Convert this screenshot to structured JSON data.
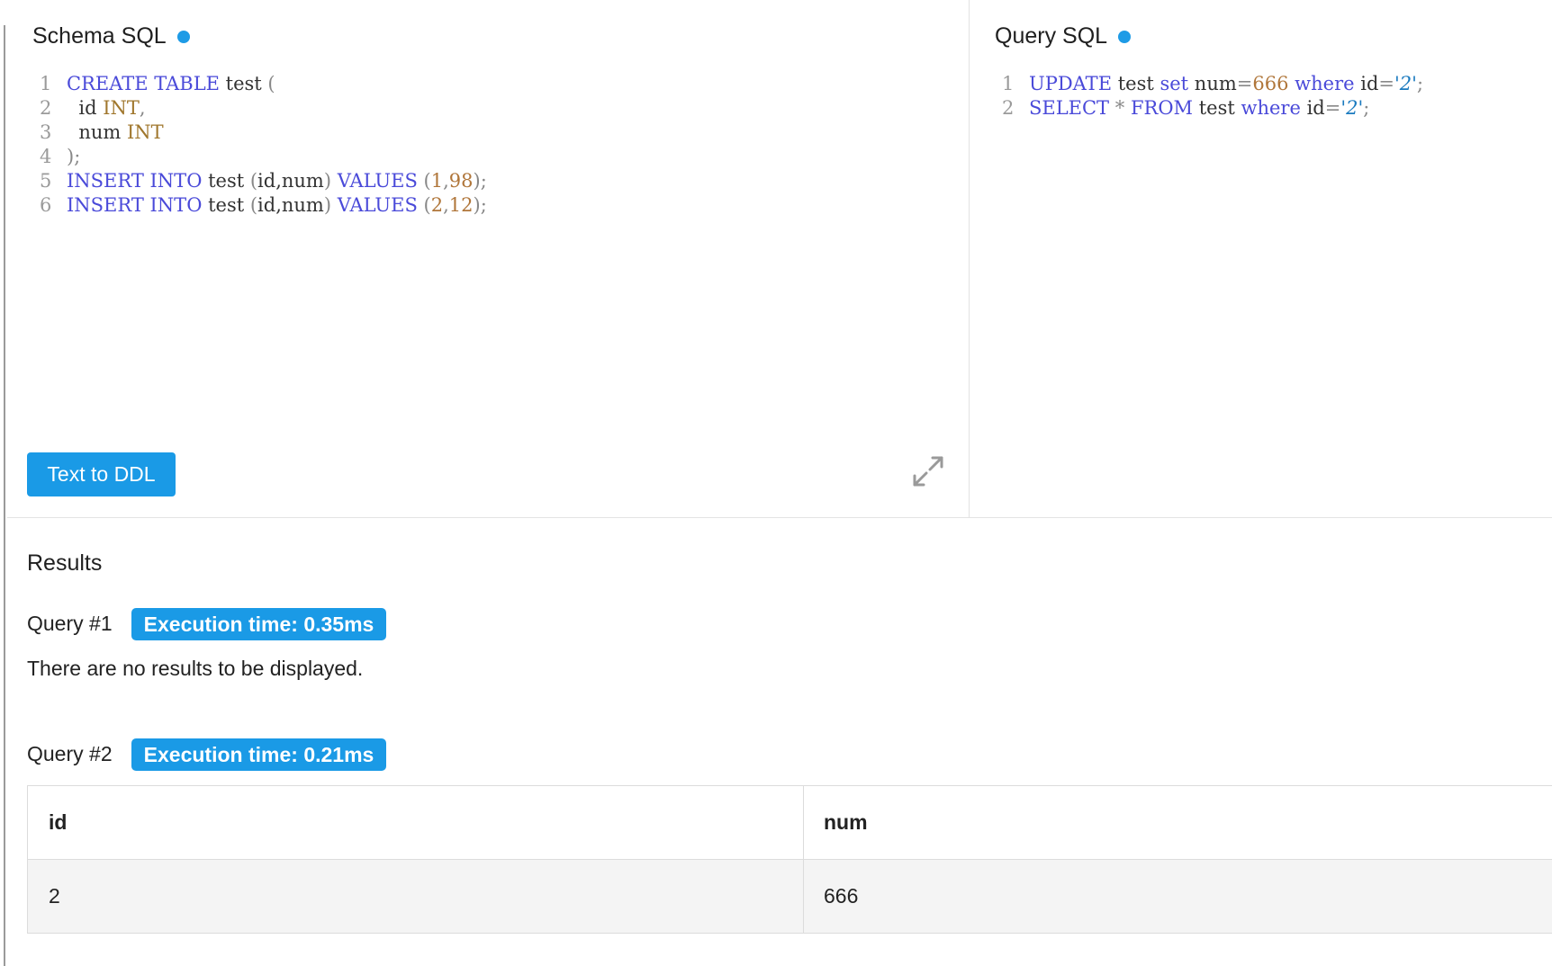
{
  "schema": {
    "title": "Schema SQL",
    "lines": [
      {
        "n": "1",
        "tokens": [
          {
            "t": "CREATE TABLE",
            "c": "kw"
          },
          {
            "t": " test ",
            "c": "pl"
          },
          {
            "t": "(",
            "c": "pun"
          }
        ]
      },
      {
        "n": "2",
        "tokens": [
          {
            "t": "  id ",
            "c": "pl"
          },
          {
            "t": "INT",
            "c": "ty"
          },
          {
            "t": ",",
            "c": "pun"
          }
        ]
      },
      {
        "n": "3",
        "tokens": [
          {
            "t": "  num ",
            "c": "pl"
          },
          {
            "t": "INT",
            "c": "ty"
          }
        ]
      },
      {
        "n": "4",
        "tokens": [
          {
            "t": ");",
            "c": "pun"
          }
        ]
      },
      {
        "n": "5",
        "tokens": [
          {
            "t": "INSERT INTO",
            "c": "kw"
          },
          {
            "t": " test ",
            "c": "pl"
          },
          {
            "t": "(",
            "c": "pun"
          },
          {
            "t": "id,num",
            "c": "pl"
          },
          {
            "t": ") ",
            "c": "pun"
          },
          {
            "t": "VALUES",
            "c": "kw"
          },
          {
            "t": " (",
            "c": "pun"
          },
          {
            "t": "1",
            "c": "num"
          },
          {
            "t": ",",
            "c": "pun"
          },
          {
            "t": "98",
            "c": "num"
          },
          {
            "t": ");",
            "c": "pun"
          }
        ]
      },
      {
        "n": "6",
        "tokens": [
          {
            "t": "INSERT INTO",
            "c": "kw"
          },
          {
            "t": " test ",
            "c": "pl"
          },
          {
            "t": "(",
            "c": "pun"
          },
          {
            "t": "id,num",
            "c": "pl"
          },
          {
            "t": ") ",
            "c": "pun"
          },
          {
            "t": "VALUES",
            "c": "kw"
          },
          {
            "t": " (",
            "c": "pun"
          },
          {
            "t": "2",
            "c": "num"
          },
          {
            "t": ",",
            "c": "pun"
          },
          {
            "t": "12",
            "c": "num"
          },
          {
            "t": ");",
            "c": "pun"
          }
        ]
      }
    ],
    "ddl_button": "Text to DDL",
    "expand_icon": "expand-icon"
  },
  "query": {
    "title": "Query SQL",
    "lines": [
      {
        "n": "1",
        "tokens": [
          {
            "t": "UPDATE",
            "c": "kw"
          },
          {
            "t": " test ",
            "c": "pl"
          },
          {
            "t": "set",
            "c": "kw"
          },
          {
            "t": " num",
            "c": "pl"
          },
          {
            "t": "=",
            "c": "pun"
          },
          {
            "t": "666",
            "c": "num"
          },
          {
            "t": " ",
            "c": "pl"
          },
          {
            "t": "where",
            "c": "kw"
          },
          {
            "t": " id",
            "c": "pl"
          },
          {
            "t": "=",
            "c": "pun"
          },
          {
            "t": "'2'",
            "c": "str"
          },
          {
            "t": ";",
            "c": "pun"
          }
        ]
      },
      {
        "n": "2",
        "tokens": [
          {
            "t": "SELECT",
            "c": "kw"
          },
          {
            "t": " ",
            "c": "pl"
          },
          {
            "t": "*",
            "c": "pun"
          },
          {
            "t": " ",
            "c": "pl"
          },
          {
            "t": "FROM",
            "c": "kw"
          },
          {
            "t": " test ",
            "c": "pl"
          },
          {
            "t": "where",
            "c": "kw"
          },
          {
            "t": " id",
            "c": "pl"
          },
          {
            "t": "=",
            "c": "pun"
          },
          {
            "t": "'2'",
            "c": "str"
          },
          {
            "t": ";",
            "c": "pun"
          }
        ]
      }
    ]
  },
  "results": {
    "title": "Results",
    "queries": [
      {
        "label": "Query #1",
        "exec_time": "Execution time: 0.35ms",
        "message": "There are no results to be displayed."
      },
      {
        "label": "Query #2",
        "exec_time": "Execution time: 0.21ms",
        "columns": [
          "id",
          "num"
        ],
        "rows": [
          [
            "2",
            "666"
          ]
        ]
      }
    ]
  },
  "colors": {
    "accent": "#1a9ae6",
    "keyword": "#4a4ad9",
    "type": "#a0772d",
    "number": "#b0763a",
    "string": "#1a7abf"
  }
}
